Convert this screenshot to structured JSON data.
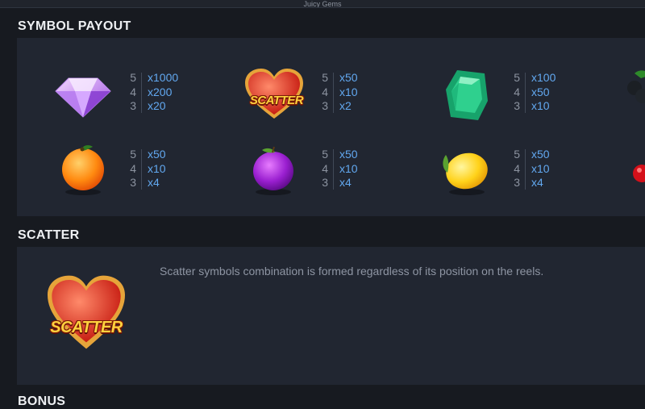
{
  "header": {
    "title": "Juicy Gems"
  },
  "sections": {
    "symbol_payout": "SYMBOL PAYOUT",
    "scatter": "SCATTER",
    "bonus": "BONUS"
  },
  "symbols": [
    {
      "icon": "diamond-icon",
      "payouts": [
        {
          "count": "5",
          "mult": "x1000"
        },
        {
          "count": "4",
          "mult": "x200"
        },
        {
          "count": "3",
          "mult": "x20"
        }
      ]
    },
    {
      "icon": "scatter-heart-icon",
      "badge": "SCATTER",
      "payouts": [
        {
          "count": "5",
          "mult": "x50"
        },
        {
          "count": "4",
          "mult": "x10"
        },
        {
          "count": "3",
          "mult": "x2"
        }
      ]
    },
    {
      "icon": "emerald-icon",
      "payouts": [
        {
          "count": "5",
          "mult": "x100"
        },
        {
          "count": "4",
          "mult": "x50"
        },
        {
          "count": "3",
          "mult": "x10"
        }
      ]
    },
    {
      "icon": "orange-icon",
      "payouts": [
        {
          "count": "5",
          "mult": "x50"
        },
        {
          "count": "4",
          "mult": "x10"
        },
        {
          "count": "3",
          "mult": "x4"
        }
      ]
    },
    {
      "icon": "plum-icon",
      "payouts": [
        {
          "count": "5",
          "mult": "x50"
        },
        {
          "count": "4",
          "mult": "x10"
        },
        {
          "count": "3",
          "mult": "x4"
        }
      ]
    },
    {
      "icon": "lemon-icon",
      "payouts": [
        {
          "count": "5",
          "mult": "x50"
        },
        {
          "count": "4",
          "mult": "x10"
        },
        {
          "count": "3",
          "mult": "x4"
        }
      ]
    }
  ],
  "partial_symbols": [
    "grapes-icon",
    "cherry-icon"
  ],
  "scatter": {
    "badge": "SCATTER",
    "description": "Scatter symbols combination is formed regardless of its position on the reels."
  },
  "colors": {
    "background": "#171a20",
    "panel": "#212631",
    "multiplier": "#62a8f0",
    "count": "#8c93a0"
  }
}
